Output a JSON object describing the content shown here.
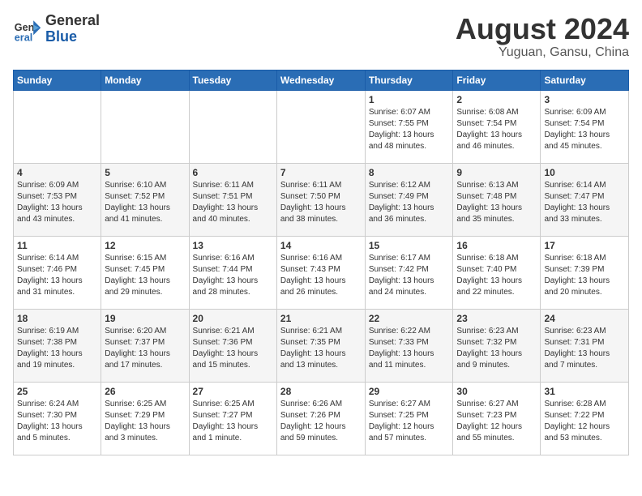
{
  "header": {
    "logo_general": "General",
    "logo_blue": "Blue",
    "month_title": "August 2024",
    "subtitle": "Yuguan, Gansu, China"
  },
  "calendar": {
    "days_of_week": [
      "Sunday",
      "Monday",
      "Tuesday",
      "Wednesday",
      "Thursday",
      "Friday",
      "Saturday"
    ],
    "weeks": [
      [
        {
          "day": "",
          "info": ""
        },
        {
          "day": "",
          "info": ""
        },
        {
          "day": "",
          "info": ""
        },
        {
          "day": "",
          "info": ""
        },
        {
          "day": "1",
          "info": "Sunrise: 6:07 AM\nSunset: 7:55 PM\nDaylight: 13 hours\nand 48 minutes."
        },
        {
          "day": "2",
          "info": "Sunrise: 6:08 AM\nSunset: 7:54 PM\nDaylight: 13 hours\nand 46 minutes."
        },
        {
          "day": "3",
          "info": "Sunrise: 6:09 AM\nSunset: 7:54 PM\nDaylight: 13 hours\nand 45 minutes."
        }
      ],
      [
        {
          "day": "4",
          "info": "Sunrise: 6:09 AM\nSunset: 7:53 PM\nDaylight: 13 hours\nand 43 minutes."
        },
        {
          "day": "5",
          "info": "Sunrise: 6:10 AM\nSunset: 7:52 PM\nDaylight: 13 hours\nand 41 minutes."
        },
        {
          "day": "6",
          "info": "Sunrise: 6:11 AM\nSunset: 7:51 PM\nDaylight: 13 hours\nand 40 minutes."
        },
        {
          "day": "7",
          "info": "Sunrise: 6:11 AM\nSunset: 7:50 PM\nDaylight: 13 hours\nand 38 minutes."
        },
        {
          "day": "8",
          "info": "Sunrise: 6:12 AM\nSunset: 7:49 PM\nDaylight: 13 hours\nand 36 minutes."
        },
        {
          "day": "9",
          "info": "Sunrise: 6:13 AM\nSunset: 7:48 PM\nDaylight: 13 hours\nand 35 minutes."
        },
        {
          "day": "10",
          "info": "Sunrise: 6:14 AM\nSunset: 7:47 PM\nDaylight: 13 hours\nand 33 minutes."
        }
      ],
      [
        {
          "day": "11",
          "info": "Sunrise: 6:14 AM\nSunset: 7:46 PM\nDaylight: 13 hours\nand 31 minutes."
        },
        {
          "day": "12",
          "info": "Sunrise: 6:15 AM\nSunset: 7:45 PM\nDaylight: 13 hours\nand 29 minutes."
        },
        {
          "day": "13",
          "info": "Sunrise: 6:16 AM\nSunset: 7:44 PM\nDaylight: 13 hours\nand 28 minutes."
        },
        {
          "day": "14",
          "info": "Sunrise: 6:16 AM\nSunset: 7:43 PM\nDaylight: 13 hours\nand 26 minutes."
        },
        {
          "day": "15",
          "info": "Sunrise: 6:17 AM\nSunset: 7:42 PM\nDaylight: 13 hours\nand 24 minutes."
        },
        {
          "day": "16",
          "info": "Sunrise: 6:18 AM\nSunset: 7:40 PM\nDaylight: 13 hours\nand 22 minutes."
        },
        {
          "day": "17",
          "info": "Sunrise: 6:18 AM\nSunset: 7:39 PM\nDaylight: 13 hours\nand 20 minutes."
        }
      ],
      [
        {
          "day": "18",
          "info": "Sunrise: 6:19 AM\nSunset: 7:38 PM\nDaylight: 13 hours\nand 19 minutes."
        },
        {
          "day": "19",
          "info": "Sunrise: 6:20 AM\nSunset: 7:37 PM\nDaylight: 13 hours\nand 17 minutes."
        },
        {
          "day": "20",
          "info": "Sunrise: 6:21 AM\nSunset: 7:36 PM\nDaylight: 13 hours\nand 15 minutes."
        },
        {
          "day": "21",
          "info": "Sunrise: 6:21 AM\nSunset: 7:35 PM\nDaylight: 13 hours\nand 13 minutes."
        },
        {
          "day": "22",
          "info": "Sunrise: 6:22 AM\nSunset: 7:33 PM\nDaylight: 13 hours\nand 11 minutes."
        },
        {
          "day": "23",
          "info": "Sunrise: 6:23 AM\nSunset: 7:32 PM\nDaylight: 13 hours\nand 9 minutes."
        },
        {
          "day": "24",
          "info": "Sunrise: 6:23 AM\nSunset: 7:31 PM\nDaylight: 13 hours\nand 7 minutes."
        }
      ],
      [
        {
          "day": "25",
          "info": "Sunrise: 6:24 AM\nSunset: 7:30 PM\nDaylight: 13 hours\nand 5 minutes."
        },
        {
          "day": "26",
          "info": "Sunrise: 6:25 AM\nSunset: 7:29 PM\nDaylight: 13 hours\nand 3 minutes."
        },
        {
          "day": "27",
          "info": "Sunrise: 6:25 AM\nSunset: 7:27 PM\nDaylight: 13 hours\nand 1 minute."
        },
        {
          "day": "28",
          "info": "Sunrise: 6:26 AM\nSunset: 7:26 PM\nDaylight: 12 hours\nand 59 minutes."
        },
        {
          "day": "29",
          "info": "Sunrise: 6:27 AM\nSunset: 7:25 PM\nDaylight: 12 hours\nand 57 minutes."
        },
        {
          "day": "30",
          "info": "Sunrise: 6:27 AM\nSunset: 7:23 PM\nDaylight: 12 hours\nand 55 minutes."
        },
        {
          "day": "31",
          "info": "Sunrise: 6:28 AM\nSunset: 7:22 PM\nDaylight: 12 hours\nand 53 minutes."
        }
      ]
    ]
  }
}
